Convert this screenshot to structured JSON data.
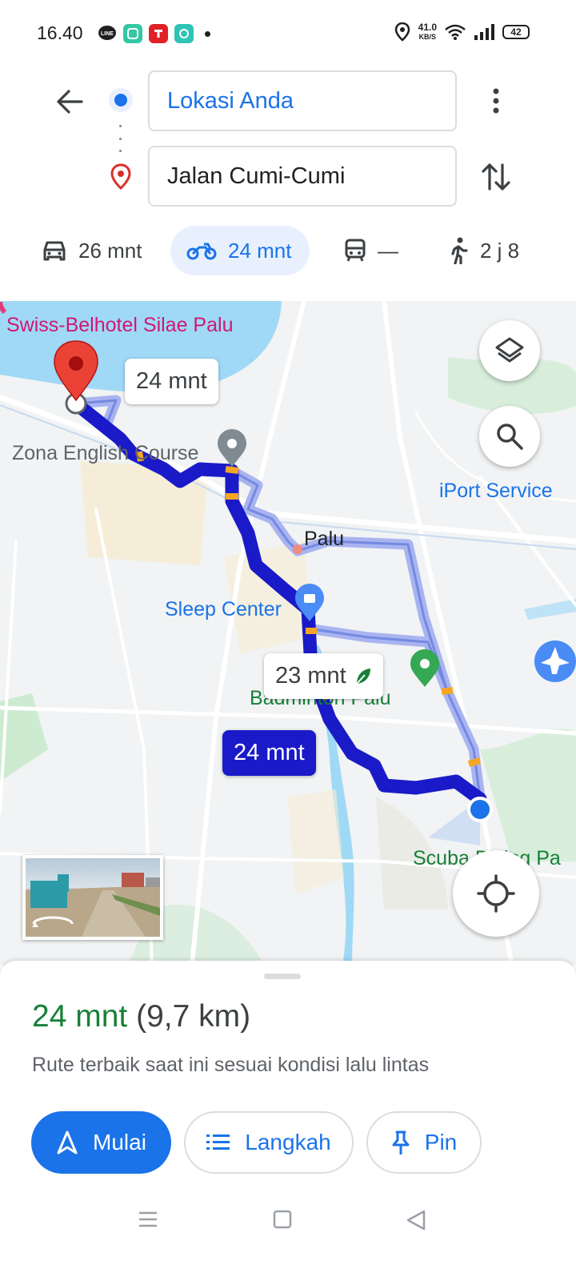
{
  "status_bar": {
    "time": "16.40",
    "net_speed_value": "41.0",
    "net_speed_unit": "KB/S",
    "battery": "42",
    "icons": [
      "line-icon",
      "app-icon",
      "telkomsel-icon",
      "app-icon",
      "dot-icon",
      "location-icon",
      "wifi-icon",
      "signal-icon",
      "battery-icon"
    ]
  },
  "directions": {
    "origin": "Lokasi Anda",
    "destination": "Jalan Cumi-Cumi"
  },
  "modes": [
    {
      "icon": "car-icon",
      "label": "26 mnt",
      "active": false
    },
    {
      "icon": "motorcycle-icon",
      "label": "24 mnt",
      "active": true
    },
    {
      "icon": "transit-icon",
      "label": "—",
      "active": false
    },
    {
      "icon": "walk-icon",
      "label": "2 j 8",
      "active": false
    }
  ],
  "map": {
    "places": {
      "hotel": "Swiss-Belhotel Silae Palu",
      "course": "Zona English Course",
      "iport": "iPort Service",
      "palu": "Palu",
      "sleep": "Sleep Center",
      "badminton": "Badminton Palu",
      "scuba": "Scuba Diving Pa"
    },
    "eta_dest": "24 mnt",
    "eta_alt": "23 mnt",
    "eta_primary": "24 mnt",
    "colors": {
      "route_primary": "#1a1ac8",
      "route_alt": "#a8b4f0",
      "water": "#9fd9f6",
      "road": "#ffffff"
    }
  },
  "sheet": {
    "duration": "24 mnt",
    "distance": "(9,7 km)",
    "description": "Rute terbaik saat ini sesuai kondisi lalu lintas",
    "start_label": "Mulai",
    "steps_label": "Langkah",
    "pin_label": "Pin"
  }
}
